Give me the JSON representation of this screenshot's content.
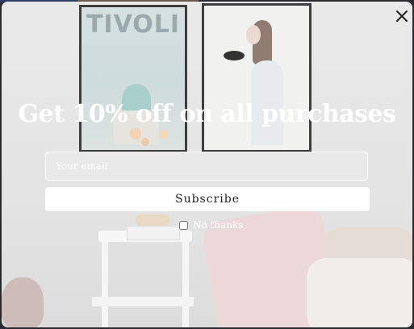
{
  "popup": {
    "headline": "Get 10% off on all purchases",
    "email_placeholder": "Your email",
    "subscribe_label": "Subscribe",
    "no_thanks_label": "No thanks",
    "close_icon": "close-icon"
  },
  "background_image": {
    "poster_text": "TIVOLI"
  },
  "colors": {
    "frame": "#3d3d3d",
    "button_bg": "#ffffff",
    "text": "#ffffff"
  }
}
